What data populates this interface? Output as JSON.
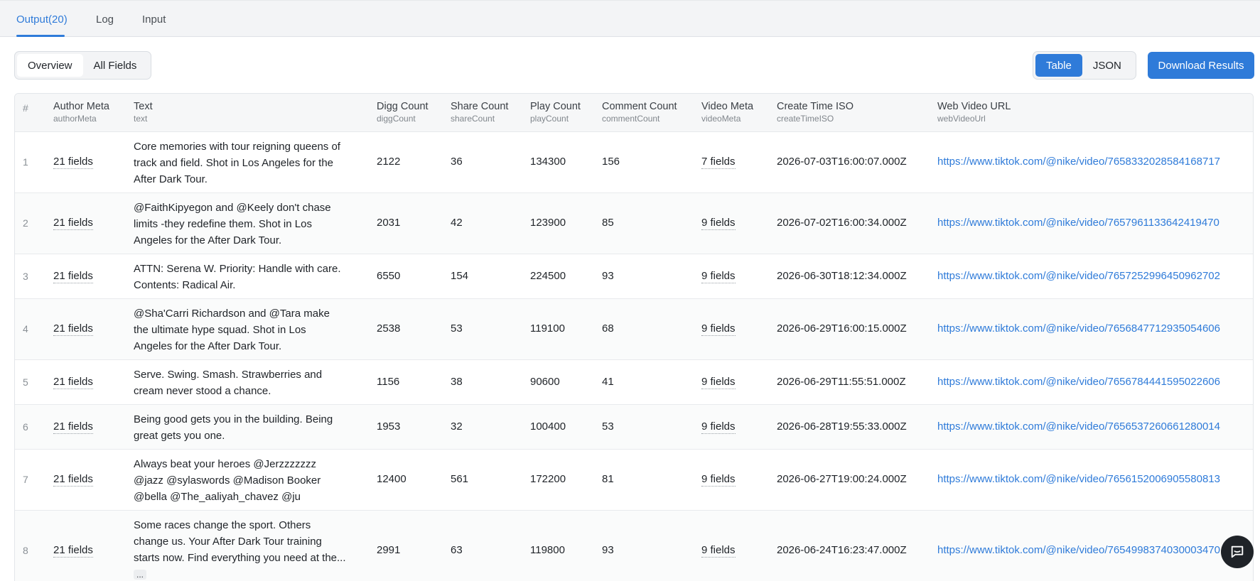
{
  "tabs": [
    {
      "label": "Output(20)"
    },
    {
      "label": "Log"
    },
    {
      "label": "Input"
    }
  ],
  "view_toggle": {
    "overview": "Overview",
    "all_fields": "All Fields"
  },
  "format_toggle": {
    "table": "Table",
    "json": "JSON"
  },
  "download_label": "Download Results",
  "columns": [
    {
      "title": "#",
      "sub": ""
    },
    {
      "title": "Author Meta",
      "sub": "authorMeta"
    },
    {
      "title": "Text",
      "sub": "text"
    },
    {
      "title": "Digg Count",
      "sub": "diggCount"
    },
    {
      "title": "Share Count",
      "sub": "shareCount"
    },
    {
      "title": "Play Count",
      "sub": "playCount"
    },
    {
      "title": "Comment Count",
      "sub": "commentCount"
    },
    {
      "title": "Video Meta",
      "sub": "videoMeta"
    },
    {
      "title": "Create Time ISO",
      "sub": "createTimeISO"
    },
    {
      "title": "Web Video URL",
      "sub": "webVideoUrl"
    }
  ],
  "rows": [
    {
      "idx": "1",
      "author": "21 fields",
      "text": "Core memories with tour reigning queens of track and field. Shot in Los Angeles for the After Dark Tour.",
      "digg": "2122",
      "share": "36",
      "play": "134300",
      "comment": "156",
      "video": "7 fields",
      "created": "2026-07-03T16:00:07.000Z",
      "url": "https://www.tiktok.com/@nike/video/7658332028584168717"
    },
    {
      "idx": "2",
      "author": "21 fields",
      "text": "@FaithKipyegon and @Keely don't chase limits -they redefine them. Shot in Los Angeles for the After Dark Tour.",
      "digg": "2031",
      "share": "42",
      "play": "123900",
      "comment": "85",
      "video": "9 fields",
      "created": "2026-07-02T16:00:34.000Z",
      "url": "https://www.tiktok.com/@nike/video/7657961133642419470"
    },
    {
      "idx": "3",
      "author": "21 fields",
      "text": "ATTN: Serena W. Priority: Handle with care. Contents: Radical Air.",
      "digg": "6550",
      "share": "154",
      "play": "224500",
      "comment": "93",
      "video": "9 fields",
      "created": "2026-06-30T18:12:34.000Z",
      "url": "https://www.tiktok.com/@nike/video/7657252996450962702"
    },
    {
      "idx": "4",
      "author": "21 fields",
      "text": "@Sha'Carri Richardson and @Tara make the ultimate hype squad. Shot in Los Angeles for the After Dark Tour.",
      "digg": "2538",
      "share": "53",
      "play": "119100",
      "comment": "68",
      "video": "9 fields",
      "created": "2026-06-29T16:00:15.000Z",
      "url": "https://www.tiktok.com/@nike/video/7656847712935054606"
    },
    {
      "idx": "5",
      "author": "21 fields",
      "text": "Serve. Swing. Smash. Strawberries and cream never stood a chance.",
      "digg": "1156",
      "share": "38",
      "play": "90600",
      "comment": "41",
      "video": "9 fields",
      "created": "2026-06-29T11:55:51.000Z",
      "url": "https://www.tiktok.com/@nike/video/7656784441595022606"
    },
    {
      "idx": "6",
      "author": "21 fields",
      "text": "Being good gets you in the building. Being great gets you one.",
      "digg": "1953",
      "share": "32",
      "play": "100400",
      "comment": "53",
      "video": "9 fields",
      "created": "2026-06-28T19:55:33.000Z",
      "url": "https://www.tiktok.com/@nike/video/7656537260661280014"
    },
    {
      "idx": "7",
      "author": "21 fields",
      "text": "Always beat your heroes @Jerzzzzzzz @jazz @sylaswords @Madison Booker @bella @The_aaliyah_chavez @ju",
      "digg": "12400",
      "share": "561",
      "play": "172200",
      "comment": "81",
      "video": "9 fields",
      "created": "2026-06-27T19:00:24.000Z",
      "url": "https://www.tiktok.com/@nike/video/7656152006905580813"
    },
    {
      "idx": "8",
      "author": "21 fields",
      "text": "Some races change the sport. Others change us. Your After Dark Tour training starts now. Find everything you need at the...",
      "more": "...",
      "digg": "2991",
      "share": "63",
      "play": "119800",
      "comment": "93",
      "video": "9 fields",
      "created": "2026-06-24T16:23:47.000Z",
      "url": "https://www.tiktok.com/@nike/video/7654998374030003470"
    }
  ],
  "icons": {
    "chat": "chat-bubble-icon"
  },
  "colors": {
    "accent": "#2f7bd9",
    "fab": "#1f2328"
  }
}
